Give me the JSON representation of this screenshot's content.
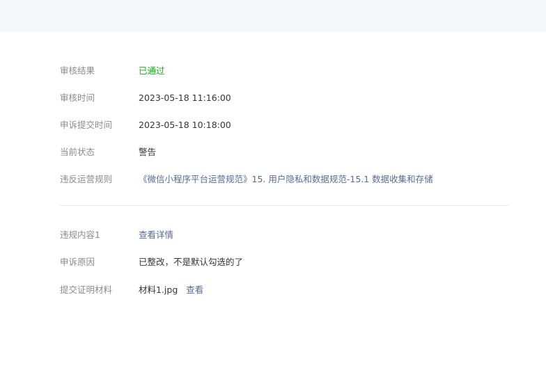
{
  "review": {
    "result": {
      "label": "审核结果",
      "value": "已通过"
    },
    "review_time": {
      "label": "审核时间",
      "value": "2023-05-18 11:16:00"
    },
    "appeal_submit_time": {
      "label": "申诉提交时间",
      "value": "2023-05-18 10:18:00"
    },
    "current_status": {
      "label": "当前状态",
      "value": "警告"
    },
    "violated_rule": {
      "label": "违反运营规则",
      "value": "《微信小程序平台运营规范》15. 用户隐私和数据规范-15.1 数据收集和存储"
    }
  },
  "appeal": {
    "violation_content": {
      "label": "违规内容1",
      "link_text": "查看详情"
    },
    "appeal_reason": {
      "label": "申诉原因",
      "value": "已整改，不是默认勾选的了"
    },
    "evidence": {
      "label": "提交证明材料",
      "file_name": "材料1.jpg",
      "view_text": "查看"
    }
  },
  "colors": {
    "success": "#1aad19",
    "link": "#576b95",
    "label": "#8c8c8c",
    "text": "#353535",
    "top_band": "#f6f7f9"
  }
}
